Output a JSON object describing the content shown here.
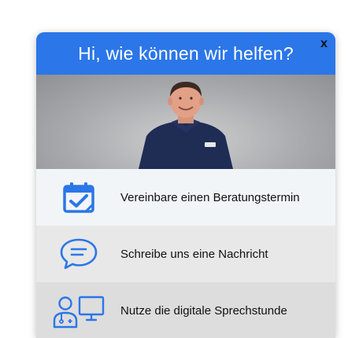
{
  "header": {
    "title": "Hi, wie können wir helfen?",
    "close_label": "x"
  },
  "options": [
    {
      "label": "Vereinbare einen Beratungstermin",
      "icon": "calendar-check-icon"
    },
    {
      "label": "Schreibe uns eine Nachricht",
      "icon": "chat-bubble-icon"
    },
    {
      "label": "Nutze die digitale Sprechstunde",
      "icon": "video-consultation-icon"
    }
  ],
  "colors": {
    "accent": "#2b76e8",
    "icon": "#2b76e8"
  }
}
